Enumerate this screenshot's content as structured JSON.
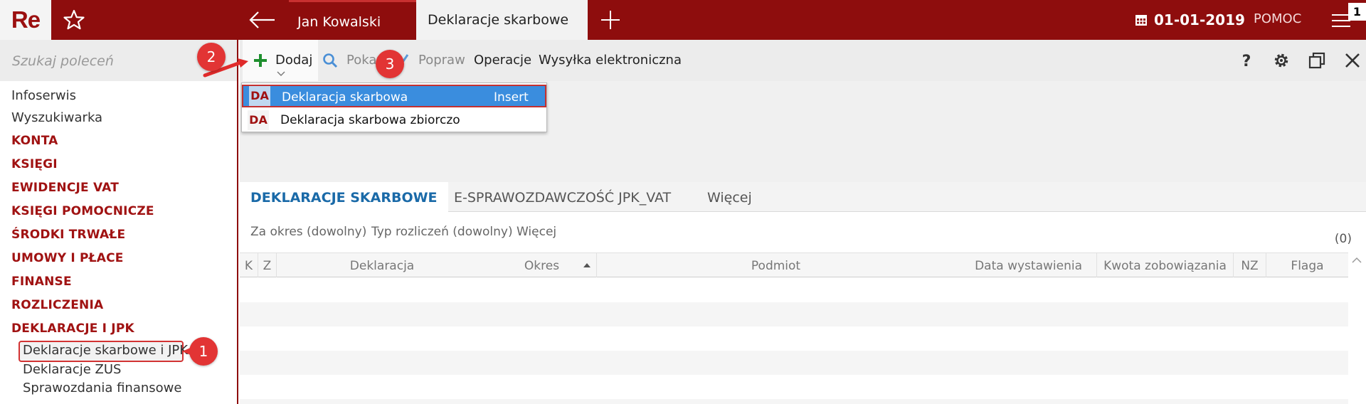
{
  "topbar": {
    "logo": "Re",
    "user_tab": "Jan Kowalski",
    "active_tab": "Deklaracje skarbowe",
    "date": "01-01-2019",
    "help": "POMOC",
    "badge": "1",
    "colors": {
      "brand": "#8e0d0d",
      "accent_red": "#a01212"
    }
  },
  "sidebar": {
    "search_placeholder": "Szukaj poleceń",
    "items": [
      {
        "label": "Infoserwis",
        "kind": "plain"
      },
      {
        "label": "Wyszukiwarka",
        "kind": "plain"
      },
      {
        "label": "KONTA",
        "kind": "category"
      },
      {
        "label": "KSIĘGI",
        "kind": "category"
      },
      {
        "label": "EWIDENCJE VAT",
        "kind": "category"
      },
      {
        "label": "KSIĘGI POMOCNICZE",
        "kind": "category"
      },
      {
        "label": "ŚRODKI TRWAŁE",
        "kind": "category"
      },
      {
        "label": "UMOWY I PŁACE",
        "kind": "category"
      },
      {
        "label": "FINANSE",
        "kind": "category"
      },
      {
        "label": "ROZLICZENIA",
        "kind": "category"
      },
      {
        "label": "DEKLARACJE I JPK",
        "kind": "category"
      },
      {
        "label": "Deklaracje skarbowe i JPK",
        "kind": "sub",
        "selected": true
      },
      {
        "label": "Deklaracje ZUS",
        "kind": "sub"
      },
      {
        "label": "Sprawozdania finansowe",
        "kind": "sub"
      }
    ]
  },
  "toolbar": {
    "add": "Dodaj",
    "show": "Pokaż",
    "edit": "Popraw",
    "operations": "Operacje",
    "send": "Wysyłka elektroniczna",
    "help_icon": "question-icon",
    "settings_icon": "gear-icon",
    "window_icon": "restore-window-icon",
    "close_icon": "close-icon"
  },
  "dropdown": {
    "items": [
      {
        "code": "DA",
        "label": "Deklaracja skarbowa",
        "shortcut": "Insert",
        "selected": true
      },
      {
        "code": "DA",
        "label": "Deklaracja skarbowa zbiorczo",
        "shortcut": ""
      }
    ]
  },
  "tabs": [
    {
      "label": "DEKLARACJE SKARBOWE",
      "active": true
    },
    {
      "label": "E-SPRAWOZDAWCZOŚĆ JPK_VAT",
      "active": false
    },
    {
      "label": "Więcej",
      "active": false
    }
  ],
  "filters": [
    "Za okres (dowolny)",
    "Typ rozliczeń (dowolny)",
    "Więcej"
  ],
  "count": "(0)",
  "grid": {
    "columns": [
      "K",
      "Z",
      "Deklaracja",
      "Okres",
      "Podmiot",
      "Data wystawienia",
      "Kwota zobowiązania",
      "NZ",
      "Flaga"
    ],
    "rows": []
  },
  "annotations": [
    "1",
    "2",
    "3"
  ]
}
